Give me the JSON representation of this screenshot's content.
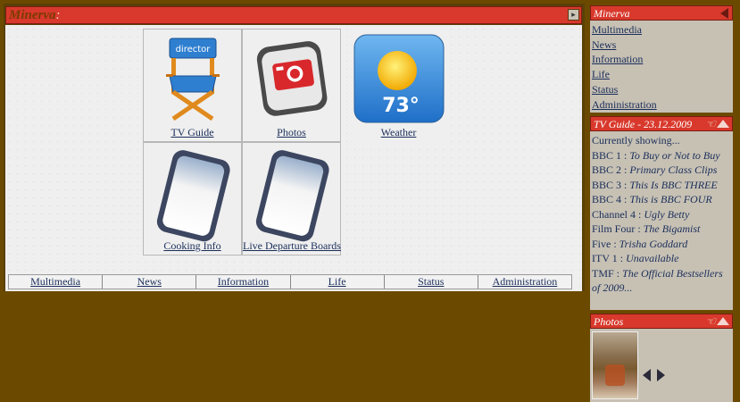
{
  "main": {
    "title": "Minerva",
    "tiles": [
      {
        "label": "TV Guide",
        "icon": "director-chair-icon"
      },
      {
        "label": "Photos",
        "icon": "camera-icon"
      },
      {
        "label": "Weather",
        "icon": "weather-sun-icon",
        "temperature": "73°"
      },
      {
        "label": "Cooking Info",
        "icon": "blank-document-icon"
      },
      {
        "label": "Live Departure Boards",
        "icon": "blank-document-icon"
      }
    ],
    "chair_text": "director",
    "nav": [
      "Multimedia",
      "News",
      "Information",
      "Life",
      "Status",
      "Administration"
    ]
  },
  "sidebar": {
    "menu": {
      "title": "Minerva",
      "items": [
        "Multimedia",
        "News",
        "Information",
        "Life",
        "Status",
        "Administration"
      ]
    },
    "tv": {
      "title": "TV Guide - 23.12.2009",
      "showing": "Currently showing...",
      "entries": [
        {
          "channel": "BBC 1 : ",
          "show": "To Buy or Not to Buy"
        },
        {
          "channel": "BBC 2 : ",
          "show": "Primary Class Clips"
        },
        {
          "channel": "BBC 3 : ",
          "show": "This Is BBC THREE"
        },
        {
          "channel": "BBC 4 : ",
          "show": "This is BBC FOUR"
        },
        {
          "channel": "Channel 4 : ",
          "show": "Ugly Betty"
        },
        {
          "channel": "Film Four : ",
          "show": "The Bigamist"
        },
        {
          "channel": "Five : ",
          "show": "Trisha Goddard"
        },
        {
          "channel": "ITV 1 : ",
          "show": "Unavailable"
        },
        {
          "channel": "TMF : ",
          "show": "The Official Bestsellers of 2009..."
        }
      ]
    },
    "photos": {
      "title": "Photos"
    }
  },
  "colors": {
    "background": "#6b4a00",
    "titlebar": "#d8392c",
    "panel": "#c7c1b4",
    "link": "#1a2e5a"
  }
}
